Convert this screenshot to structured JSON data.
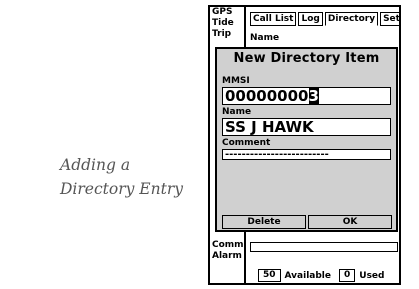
{
  "caption": "Adding a Directory Entry",
  "sidebar": {
    "top_items": [
      "GPS",
      "Tide",
      "Trip"
    ],
    "bottom_items": [
      "Comm",
      "Alarm"
    ]
  },
  "tabs": [
    "Call List",
    "Log",
    "Directory",
    "Setup"
  ],
  "active_tab": "Directory",
  "list_header": "Name",
  "dialog": {
    "title": "New Directory Item",
    "mmsi_label": "MMSI",
    "mmsi_value": "00000000",
    "mmsi_cursor": "3",
    "name_label": "Name",
    "name_value": "SS J HAWK",
    "comment_label": "Comment",
    "comment_value": "-------------------------",
    "delete_label": "Delete",
    "ok_label": "OK"
  },
  "status": {
    "available_count": "50",
    "available_label": "Available",
    "used_count": "0",
    "used_label": "Used"
  }
}
